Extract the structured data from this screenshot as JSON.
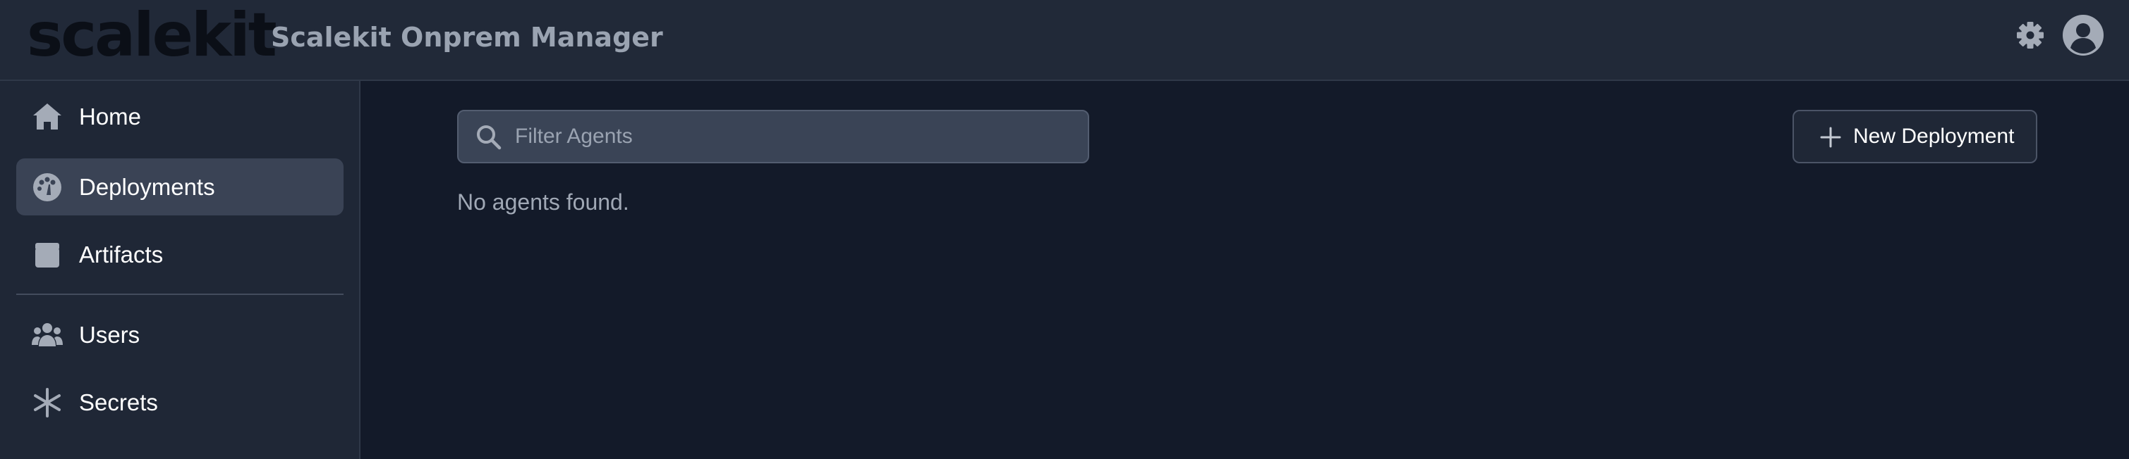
{
  "header": {
    "logo_text": "scalekit",
    "app_title": "Scalekit Onprem Manager",
    "settings_icon": "gear-icon",
    "account_icon": "user-circle-icon"
  },
  "sidebar": {
    "items": [
      {
        "label": "Home",
        "icon": "home-icon",
        "active": false
      },
      {
        "label": "Deployments",
        "icon": "dashboard-gauge-icon",
        "active": true
      },
      {
        "label": "Artifacts",
        "icon": "archive-box-icon",
        "active": false
      },
      {
        "label": "Users",
        "icon": "users-icon",
        "active": false
      },
      {
        "label": "Secrets",
        "icon": "asterisk-icon",
        "active": false
      }
    ]
  },
  "main": {
    "filter": {
      "placeholder": "Filter Agents",
      "value": ""
    },
    "new_button_label": "New Deployment",
    "empty_message": "No agents found."
  },
  "colors": {
    "header_bg": "#212938",
    "sidebar_bg": "#1f2736",
    "main_bg": "#131a29",
    "active_item_bg": "#3a4355",
    "icon_gray": "#a4abb7"
  }
}
